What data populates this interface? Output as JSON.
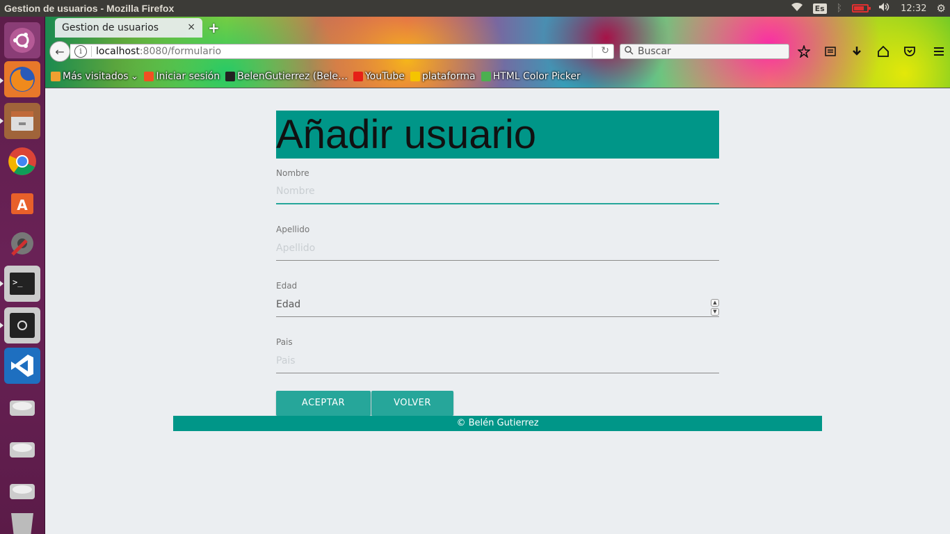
{
  "system": {
    "window_title": "Gestion de usuarios - Mozilla Firefox",
    "keyboard_layout": "Es",
    "clock": "12:32",
    "battery_level": 0.8
  },
  "browser": {
    "tab_title": "Gestion de usuarios",
    "tab_close": "×",
    "new_tab": "+",
    "url_host": "localhost",
    "url_path": ":8080/formulario",
    "search_placeholder": "Buscar",
    "bookmarks": [
      {
        "label": "Más visitados",
        "color": "#f0a030"
      },
      {
        "label": "Iniciar sesión",
        "color": "#f25022"
      },
      {
        "label": "BelenGutierrez (Bele…",
        "color": "#222222"
      },
      {
        "label": "YouTube",
        "color": "#e62117"
      },
      {
        "label": "plataforma",
        "color": "#f5c400"
      },
      {
        "label": "HTML Color Picker",
        "color": "#4caf50"
      }
    ]
  },
  "form": {
    "title": "Añadir usuario",
    "fields": [
      {
        "label": "Nombre",
        "placeholder": "Nombre"
      },
      {
        "label": "Apellido",
        "placeholder": "Apellido"
      },
      {
        "label": "Edad",
        "placeholder": "Edad"
      },
      {
        "label": "Pais",
        "placeholder": "Pais"
      }
    ],
    "accept_label": "ACEPTAR",
    "back_label": "VOLVER",
    "footer": "© Belén Gutierrez"
  },
  "colors": {
    "primary": "#009688",
    "button": "#26a69a",
    "page_bg": "#ebeef1",
    "launcher": "#5d1d4a"
  }
}
